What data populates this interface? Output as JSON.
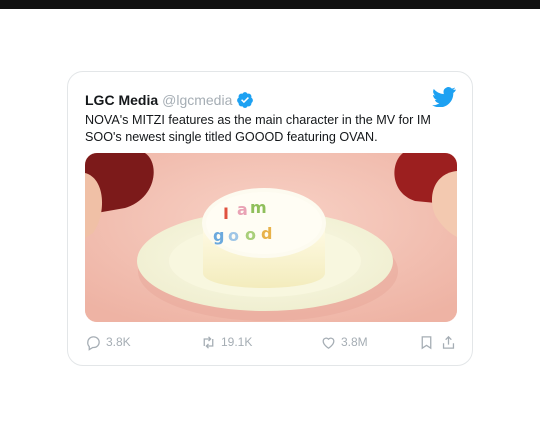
{
  "tweet": {
    "display_name": "LGC Media",
    "handle": "@lgcmedia",
    "text": "NOVA's MITZI features as the main character in the MV for IM SOO's newest single titled GOOOD featuring OVAN.",
    "media_icons": [
      "cake-plate-image"
    ],
    "stats": {
      "replies": "3.8K",
      "retweets": "19.1K",
      "likes": "3.8M"
    }
  },
  "icons": {
    "verified": "verified-badge-icon",
    "brand": "twitter-bird-icon",
    "reply": "reply-icon",
    "retweet": "retweet-icon",
    "like": "heart-icon",
    "bookmark": "bookmark-icon",
    "share": "share-icon"
  },
  "colors": {
    "brand": "#1da1f2",
    "text": "#14171a",
    "muted": "#a5adb4",
    "border": "#e3e6e8"
  }
}
